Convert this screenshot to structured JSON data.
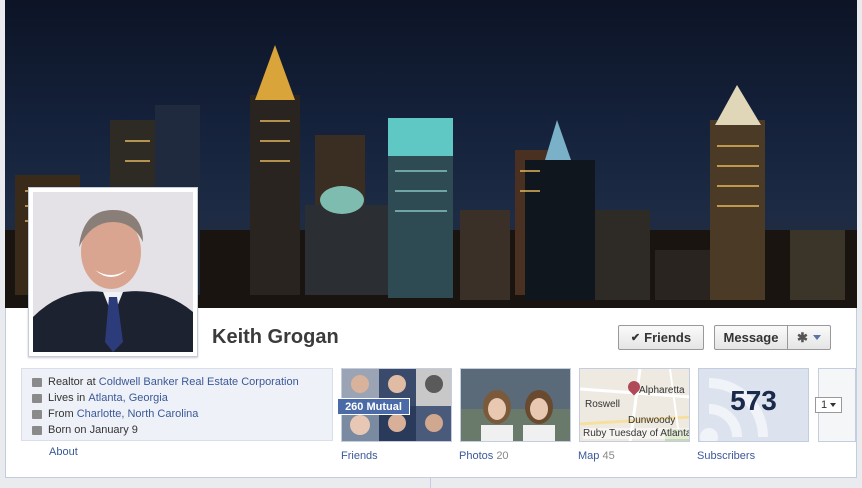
{
  "profile": {
    "name": "Keith Grogan",
    "friends_button": "Friends",
    "message_button": "Message"
  },
  "info": {
    "work_prefix": "Realtor at ",
    "work_link": "Coldwell Banker Real Estate Corporation",
    "lives_prefix": "Lives in ",
    "lives_link": "Atlanta, Georgia",
    "from_prefix": "From ",
    "from_link": "Charlotte, North Carolina",
    "born": "Born on January 9",
    "about": "About"
  },
  "tiles": {
    "friends_label": "Friends",
    "mutual": "260 Mutual",
    "photos_label": "Photos",
    "photos_count": "20",
    "map_label": "Map",
    "map_count": "45",
    "map_places": [
      "Alpharetta",
      "Roswell",
      "Dunwoody",
      "Ruby Tuesday of Atlanta"
    ],
    "subscribers_label": "Subscribers",
    "subscribers_count": "573",
    "more_value": "1"
  },
  "icons": [
    "check-icon",
    "gear-icon",
    "briefcase-icon",
    "home-icon",
    "location-icon",
    "birthday-icon",
    "map-pin-icon",
    "rss-icon"
  ],
  "colors": {
    "link": "#3b5998",
    "accent": "#4a6ba7"
  }
}
